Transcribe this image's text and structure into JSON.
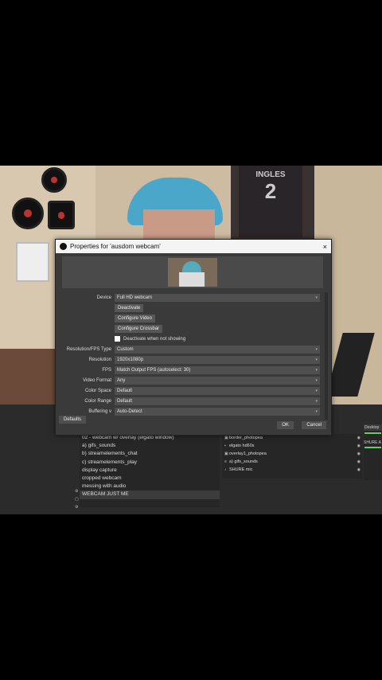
{
  "dialog": {
    "title": "Properties for 'ausdom webcam'",
    "close": "×",
    "properties": {
      "device": {
        "label": "Device",
        "value": "Full HD webcam"
      },
      "buttons": {
        "deactivate": "Deactivate",
        "configure_video": "Configure Video",
        "configure_crossbar": "Configure Crossbar"
      },
      "deactivate_when_not_showing": "Deactivate when not showing",
      "resolution_fps_type": {
        "label": "Resolution/FPS Type",
        "value": "Custom"
      },
      "resolution": {
        "label": "Resolution",
        "value": "1920x1080p"
      },
      "fps": {
        "label": "FPS",
        "value": "Match Output FPS (autoselect: 30)"
      },
      "video_format": {
        "label": "Video Format",
        "value": "Any"
      },
      "color_space": {
        "label": "Color Space",
        "value": "Default"
      },
      "color_range": {
        "label": "Color Range",
        "value": "Default"
      },
      "buffering": {
        "label": "Buffering v",
        "value": "Auto-Detect"
      }
    },
    "footer": {
      "defaults": "Defaults",
      "ok": "OK",
      "cancel": "Cancel"
    }
  },
  "scenes": [
    "02 - webcam w/ overlay (elgato window)",
    "a) gifs_sounds",
    "b) streamelements_chat",
    "c) streamelements_play",
    "display capture",
    "cropped webcam",
    "messing with audio",
    "WEBCAM JUST ME"
  ],
  "selected_scene": "WEBCAM JUST ME",
  "sources": [
    "border_photopea",
    "elgato hd60s",
    "overlay1_photopea",
    "a) gifs_sounds",
    "SHURE mic"
  ],
  "mixer": {
    "tag": "Desktop",
    "label": "SHURE A"
  },
  "background": {
    "jersey_text": "INGLES",
    "jersey_number": "2"
  }
}
